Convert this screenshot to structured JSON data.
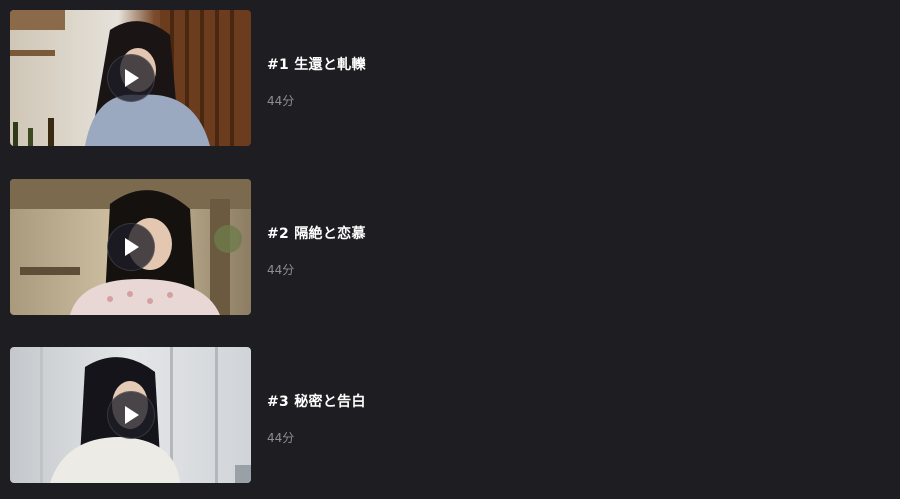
{
  "episodes": [
    {
      "title": "#1 生還と軋轢",
      "duration": "44分"
    },
    {
      "title": "#2 隔絶と恋慕",
      "duration": "44分"
    },
    {
      "title": "#3 秘密と告白",
      "duration": "44分"
    }
  ],
  "icons": {
    "play": "play-icon"
  },
  "colors": {
    "background": "#1e1e22",
    "title": "#ffffff",
    "duration": "#8d8d93"
  }
}
